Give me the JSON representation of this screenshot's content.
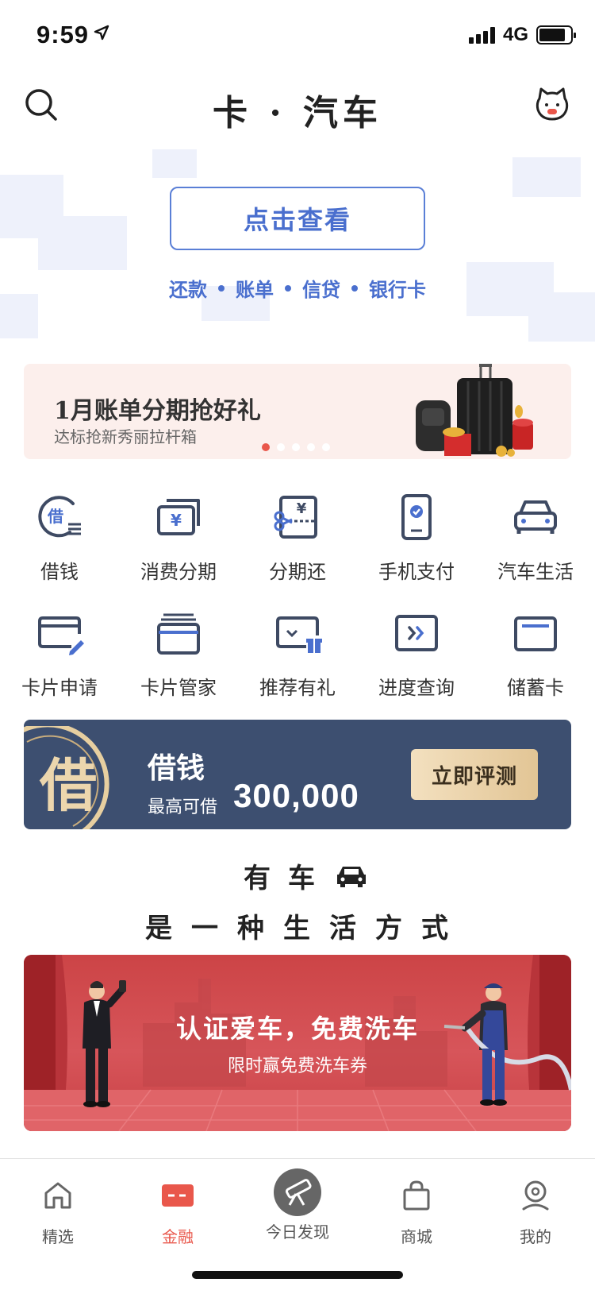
{
  "status_bar": {
    "time": "9:59",
    "network": "4G"
  },
  "header": {
    "title": "卡 · 汽车"
  },
  "hero": {
    "view_button": "点击查看",
    "links": [
      "还款",
      "账单",
      "信贷",
      "银行卡"
    ]
  },
  "promo": {
    "title": "1月账单分期抢好礼",
    "subtitle": "达标抢新秀丽拉杆箱",
    "page_count": 5,
    "active_page": 1
  },
  "grid": {
    "row1": [
      {
        "label": "借钱",
        "icon": "borrow-money-icon",
        "badge": "借"
      },
      {
        "label": "消费分期",
        "icon": "installment-card-icon",
        "badge": "¥"
      },
      {
        "label": "分期还",
        "icon": "installment-repay-icon",
        "badge": "¥"
      },
      {
        "label": "手机支付",
        "icon": "mobile-pay-icon"
      },
      {
        "label": "汽车生活",
        "icon": "car-life-icon"
      }
    ],
    "row2": [
      {
        "label": "卡片申请",
        "icon": "card-apply-icon"
      },
      {
        "label": "卡片管家",
        "icon": "card-manager-icon"
      },
      {
        "label": "推荐有礼",
        "icon": "referral-gift-icon"
      },
      {
        "label": "进度查询",
        "icon": "progress-query-icon"
      },
      {
        "label": "储蓄卡",
        "icon": "debit-card-icon"
      }
    ]
  },
  "loan_banner": {
    "seal_char": "借",
    "title": "借钱",
    "subtitle": "最高可借",
    "amount": "300,000",
    "cta": "立即评测"
  },
  "car_section": {
    "line1": "有车",
    "line2": "是一种生活方式"
  },
  "wash_banner": {
    "title": "认证爱车，免费洗车",
    "subtitle": "限时赢免费洗车券"
  },
  "tabbar": {
    "tabs": [
      {
        "label": "精选",
        "icon": "home-icon",
        "active": false
      },
      {
        "label": "金融",
        "icon": "finance-card-icon",
        "active": true
      },
      {
        "label": "今日发现",
        "icon": "telescope-icon",
        "active": false
      },
      {
        "label": "商城",
        "icon": "shopping-bag-icon",
        "active": false
      },
      {
        "label": "我的",
        "icon": "profile-icon",
        "active": false
      }
    ]
  },
  "colors": {
    "accent_blue": "#4a6fce",
    "accent_red": "#e9574b",
    "navy_banner": "#3d4f70",
    "gold_cta": "#e2c595"
  }
}
